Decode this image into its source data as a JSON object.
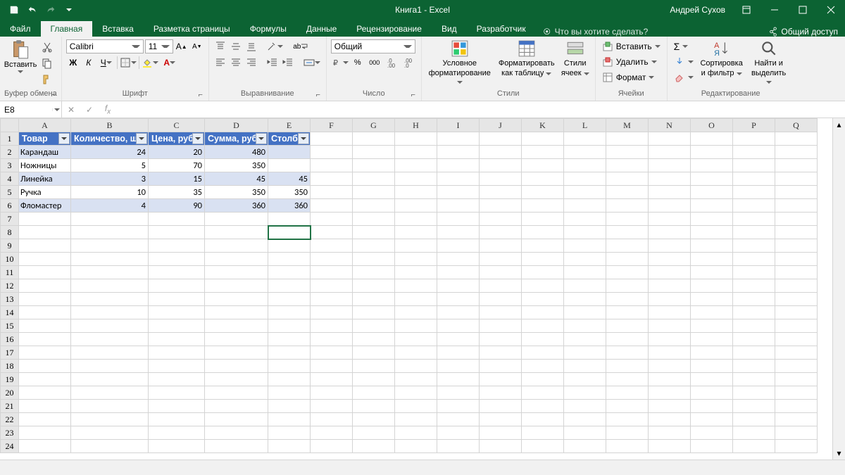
{
  "title": "Книга1  -  Excel",
  "user": "Андрей Сухов",
  "tabs": {
    "file": "Файл",
    "home": "Главная",
    "insert": "Вставка",
    "layout": "Разметка страницы",
    "formulas": "Формулы",
    "data": "Данные",
    "review": "Рецензирование",
    "view": "Вид",
    "developer": "Разработчик"
  },
  "tellme": "Что вы хотите сделать?",
  "share": "Общий доступ",
  "groups": {
    "clipboard": {
      "paste": "Вставить",
      "label": "Буфер обмена"
    },
    "font": {
      "name": "Calibri",
      "size": "11",
      "label": "Шрифт",
      "bold": "Ж",
      "italic": "К",
      "underline": "Ч"
    },
    "align": {
      "label": "Выравнивание",
      "wrap": "ab"
    },
    "number": {
      "format": "Общий",
      "label": "Число",
      "pct": "%",
      "sep": "000"
    },
    "styles": {
      "cond1": "Условное",
      "cond2": "форматирование",
      "fmt1": "Форматировать",
      "fmt2": "как таблицу",
      "cell1": "Стили",
      "cell2": "ячеек",
      "label": "Стили"
    },
    "cells": {
      "insert": "Вставить",
      "delete": "Удалить",
      "format": "Формат",
      "label": "Ячейки"
    },
    "editing": {
      "sort1": "Сортировка",
      "sort2": "и фильтр",
      "find1": "Найти и",
      "find2": "выделить",
      "label": "Редактирование"
    }
  },
  "namebox": "E8",
  "columns": [
    "A",
    "B",
    "C",
    "D",
    "E",
    "F",
    "G",
    "H",
    "I",
    "J",
    "K",
    "L",
    "M",
    "N",
    "O",
    "P",
    "Q"
  ],
  "headers": [
    "Товар",
    "Количество, шт",
    "Цена, руб",
    "Сумма, руб",
    "Столбе"
  ],
  "rows": [
    {
      "a": "Карандаш",
      "b": "24",
      "c": "20",
      "d": "480",
      "e": ""
    },
    {
      "a": "Ножницы",
      "b": "5",
      "c": "70",
      "d": "350",
      "e": ""
    },
    {
      "a": "Линейка",
      "b": "3",
      "c": "15",
      "d": "45",
      "e": "45"
    },
    {
      "a": "Ручка",
      "b": "10",
      "c": "35",
      "d": "350",
      "e": "350"
    },
    {
      "a": "Фломастер",
      "b": "4",
      "c": "90",
      "d": "360",
      "e": "360"
    }
  ],
  "row_count": 24
}
